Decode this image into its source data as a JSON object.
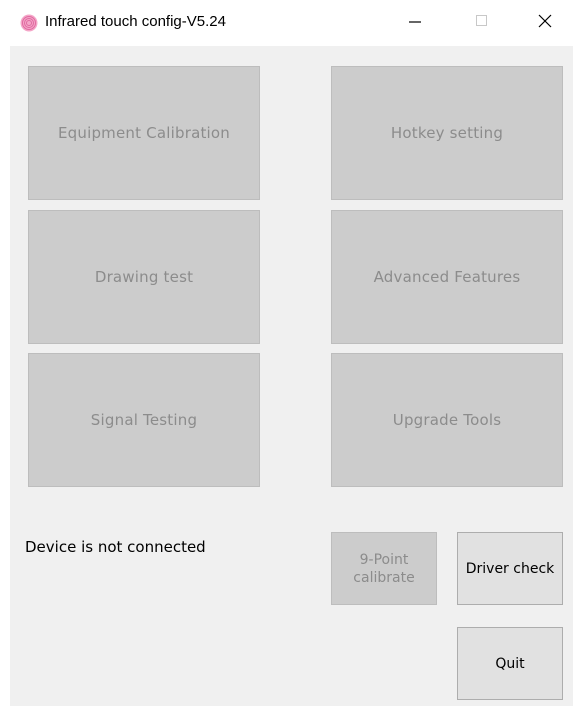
{
  "window": {
    "title": "Infrared touch config-V5.24",
    "icon": "fingerprint-icon",
    "controls": {
      "minimize_icon": "minimize-icon",
      "maximize_icon": "maximize-icon",
      "close_icon": "close-icon"
    }
  },
  "features": {
    "equipment_calibration": "Equipment Calibration",
    "hotkey_setting": "Hotkey setting",
    "drawing_test": "Drawing test",
    "advanced_features": "Advanced Features",
    "signal_testing": "Signal Testing",
    "upgrade_tools": "Upgrade Tools"
  },
  "status": {
    "message": "Device is not connected"
  },
  "actions": {
    "nine_point_calibrate": "9-Point calibrate",
    "driver_check": "Driver check",
    "quit": "Quit"
  },
  "colors": {
    "disabled_button_bg": "#cccccc",
    "disabled_text": "#8c8c8c",
    "enabled_button_bg": "#e1e1e1",
    "client_bg": "#f0f0f0",
    "icon_accent": "#f07fb0"
  }
}
